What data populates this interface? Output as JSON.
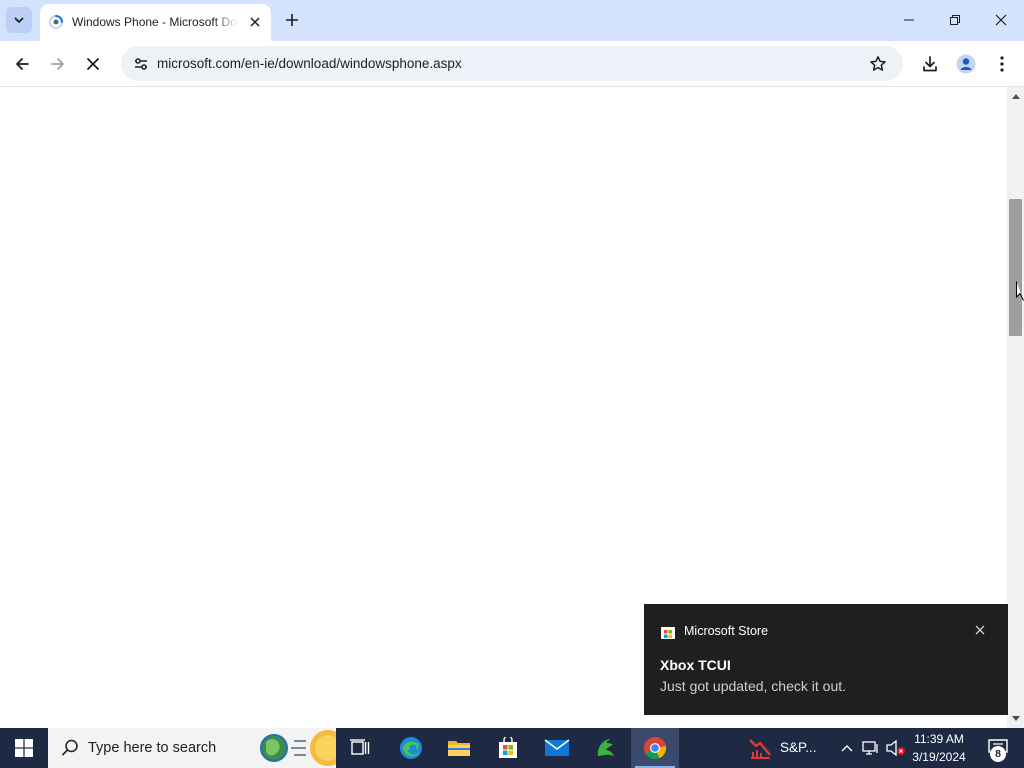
{
  "browser": {
    "tab": {
      "title": "Windows Phone - Microsoft Download Center"
    },
    "address_bar": {
      "url": "microsoft.com/en-ie/download/windowsphone.aspx"
    }
  },
  "toast": {
    "app_name": "Microsoft Store",
    "title": "Xbox TCUI",
    "body": "Just got updated, check it out."
  },
  "taskbar": {
    "search_placeholder": "Type here to search",
    "sp_app_label": "S&P...",
    "clock": {
      "time": "11:39 AM",
      "date": "3/19/2024"
    },
    "notification_count": "8"
  }
}
